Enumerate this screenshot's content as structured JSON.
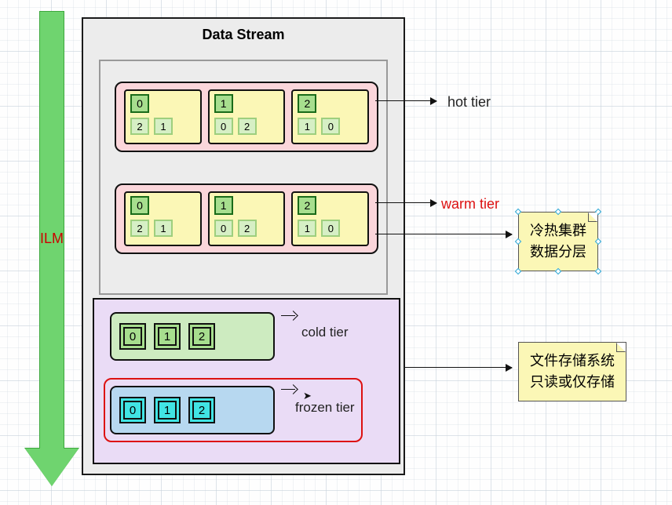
{
  "ilm_label": "ILM",
  "data_stream_title": "Data Stream",
  "tiers": {
    "hot": {
      "label": "hot tier"
    },
    "warm": {
      "label": "warm tier"
    },
    "cold": {
      "label": "cold tier"
    },
    "frozen": {
      "label": "frozen tier"
    }
  },
  "hot_nodes": [
    {
      "primary": "0",
      "replicas": [
        "2",
        "1"
      ]
    },
    {
      "primary": "1",
      "replicas": [
        "0",
        "2"
      ]
    },
    {
      "primary": "2",
      "replicas": [
        "1",
        "0"
      ]
    }
  ],
  "warm_nodes": [
    {
      "primary": "0",
      "replicas": [
        "2",
        "1"
      ]
    },
    {
      "primary": "1",
      "replicas": [
        "0",
        "2"
      ]
    },
    {
      "primary": "2",
      "replicas": [
        "1",
        "0"
      ]
    }
  ],
  "cold_shards": [
    "0",
    "1",
    "2"
  ],
  "frozen_shards": [
    "0",
    "1",
    "2"
  ],
  "notes": {
    "hot_warm": {
      "line1": "冷热集群",
      "line2": "数据分层"
    },
    "cold_frozen": {
      "line1": "文件存储系统",
      "line2": "只读或仅存储"
    }
  }
}
